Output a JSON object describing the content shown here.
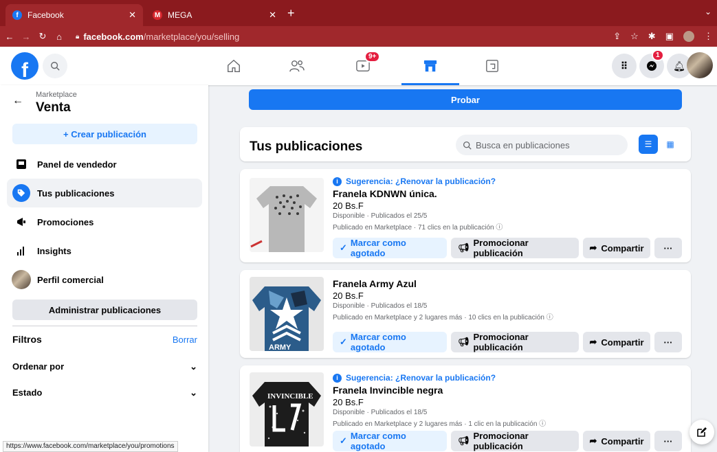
{
  "browser": {
    "tabs": [
      {
        "title": "Facebook",
        "favicon": "facebook-icon"
      },
      {
        "title": "MEGA",
        "favicon": "mega-icon"
      }
    ],
    "url_host": "facebook.com",
    "url_path": "/marketplace/you/selling",
    "status_url": "https://www.facebook.com/marketplace/you/promotions"
  },
  "header": {
    "logo": "f",
    "video_badge": "9+",
    "messenger_badge": "1"
  },
  "sidebar": {
    "breadcrumb": "Marketplace",
    "title": "Venta",
    "create_label": "+ Crear publicación",
    "items": [
      {
        "label": "Panel de vendedor",
        "icon": "dashboard-icon"
      },
      {
        "label": "Tus publicaciones",
        "icon": "tag-icon"
      },
      {
        "label": "Promociones",
        "icon": "megaphone-icon"
      },
      {
        "label": "Insights",
        "icon": "bar-chart-icon"
      },
      {
        "label": "Perfil comercial",
        "icon": "profile-avatar"
      }
    ],
    "manage_label": "Administrar publicaciones",
    "filters_label": "Filtros",
    "clear_label": "Borrar",
    "sort_label": "Ordenar por",
    "status_label": "Estado"
  },
  "main": {
    "probar_label": "Probar",
    "listings_title": "Tus publicaciones",
    "search_placeholder": "Busca en publicaciones",
    "listings": [
      {
        "suggestion": "Sugerencia: ¿Renovar la publicación?",
        "title": "Franela KDNWN única.",
        "price": "20 Bs.F",
        "status": "Disponible · Publicados el 25/5",
        "stats": "Publicado en Marketplace · 71 clics en la publicación"
      },
      {
        "suggestion": "",
        "title": "Franela Army Azul",
        "price": "20 Bs.F",
        "status": "Disponible · Publicados el 18/5",
        "stats": "Publicado en Marketplace y 2 lugares más · 10 clics en la publicación"
      },
      {
        "suggestion": "Sugerencia: ¿Renovar la publicación?",
        "title": "Franela Invincible negra",
        "price": "20 Bs.F",
        "status": "Disponible · Publicados el 18/5",
        "stats": "Publicado en Marketplace y 2 lugares más · 1 clic en la publicación"
      }
    ],
    "mark_sold_label": "Marcar como agotado",
    "promote_label": "Promocionar publicación",
    "share_label": "Compartir",
    "more_label": "···"
  },
  "colors": {
    "accent": "#1877f2",
    "browser_frame": "#8b1a1e"
  }
}
